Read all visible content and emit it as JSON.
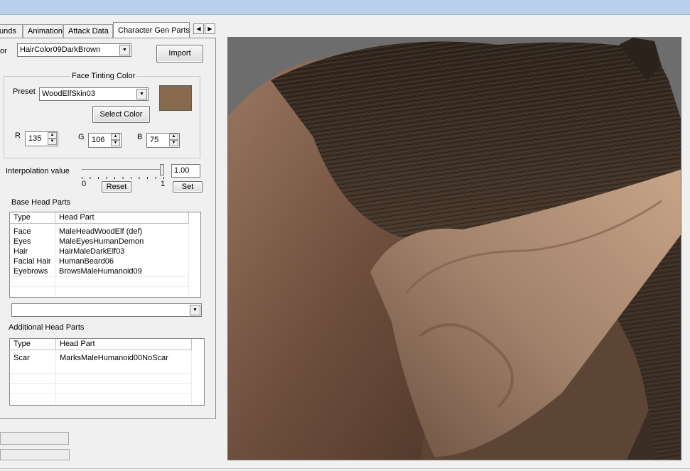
{
  "tabs": [
    {
      "label": "unds"
    },
    {
      "label": "Animation"
    },
    {
      "label": "Attack Data"
    },
    {
      "label": "Character Gen Parts"
    }
  ],
  "tab_scroll": {
    "left": "◀",
    "right": "▶"
  },
  "hair_color": {
    "label": "or",
    "value": "HairColor09DarkBrown"
  },
  "import_button": "Import",
  "face_tint": {
    "title": "Face Tinting Color",
    "preset_label": "Preset",
    "preset_value": "WoodElfSkin03",
    "select_color_button": "Select Color",
    "swatch_color": "#87694b",
    "r_label": "R",
    "r_value": "135",
    "g_label": "G",
    "g_value": "106",
    "b_label": "B",
    "b_value": "75"
  },
  "interpolation": {
    "label": "Interpolation value",
    "min_label": "0",
    "max_label": "1",
    "value": "1.00",
    "slider_fraction": 1.0,
    "reset_button": "Reset",
    "set_button": "Set"
  },
  "base_head_parts": {
    "title": "Base Head Parts",
    "columns": [
      "Type",
      "Head Part"
    ],
    "rows": [
      [
        "Face",
        "MaleHeadWoodElf (def)"
      ],
      [
        "Eyes",
        "MaleEyesHumanDemon"
      ],
      [
        "Hair",
        "HairMaleDarkElf03"
      ],
      [
        "Facial Hair",
        "HumanBeard06"
      ],
      [
        "Eyebrows",
        "BrowsMaleHumanoid09"
      ]
    ]
  },
  "head_part_select": {
    "value": ""
  },
  "additional_head_parts": {
    "title": "Additional Head Parts",
    "columns": [
      "Type",
      "Head Part"
    ],
    "rows": [
      [
        "Scar",
        "MarksMaleHumanoid00NoScar"
      ]
    ]
  },
  "icons": {
    "dropdown": "chevron-down-icon",
    "spin_up": "spin-up-icon",
    "spin_down": "spin-down-icon"
  },
  "preview_colors": {
    "background": "#6d6d6d",
    "skin": "#8a6a52",
    "hair": "#3a2e25"
  }
}
